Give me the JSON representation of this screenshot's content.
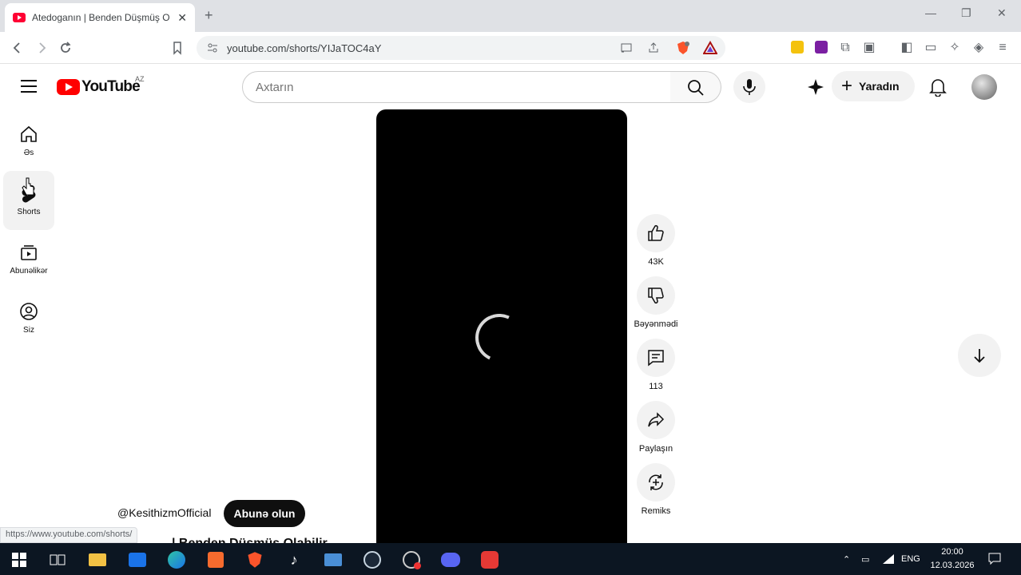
{
  "browser": {
    "tab_title": "Atedoganın | Benden Düşmüş Ol...",
    "url": "youtube.com/shorts/YIJaTOC4aY",
    "status_url": "https://www.youtube.com/shorts/"
  },
  "header": {
    "logo_text": "YouTube",
    "country_code": "AZ",
    "search_placeholder": "Axtarın",
    "create_label": "Yaradın"
  },
  "sidebar": {
    "items": [
      {
        "label": "Əs"
      },
      {
        "label": "Shorts"
      },
      {
        "label": "Abunəlikər"
      },
      {
        "label": "Siz"
      }
    ]
  },
  "actions": {
    "like_count": "43K",
    "dislike_label": "Bəyənmədi",
    "comment_count": "113",
    "share_label": "Paylaşın",
    "remix_label": "Remiks"
  },
  "video": {
    "channel": "@KesithizmOfficial",
    "subscribe_label": "Abunə olun",
    "title": "| Benden Düşmüş Olabilir"
  },
  "taskbar": {
    "lang": "ENG",
    "time": "20:00",
    "date": "12.03.2026"
  },
  "colors": {
    "yt_red": "#ff0000",
    "player_bg": "#000000",
    "taskbar_bg": "#0c1622"
  }
}
